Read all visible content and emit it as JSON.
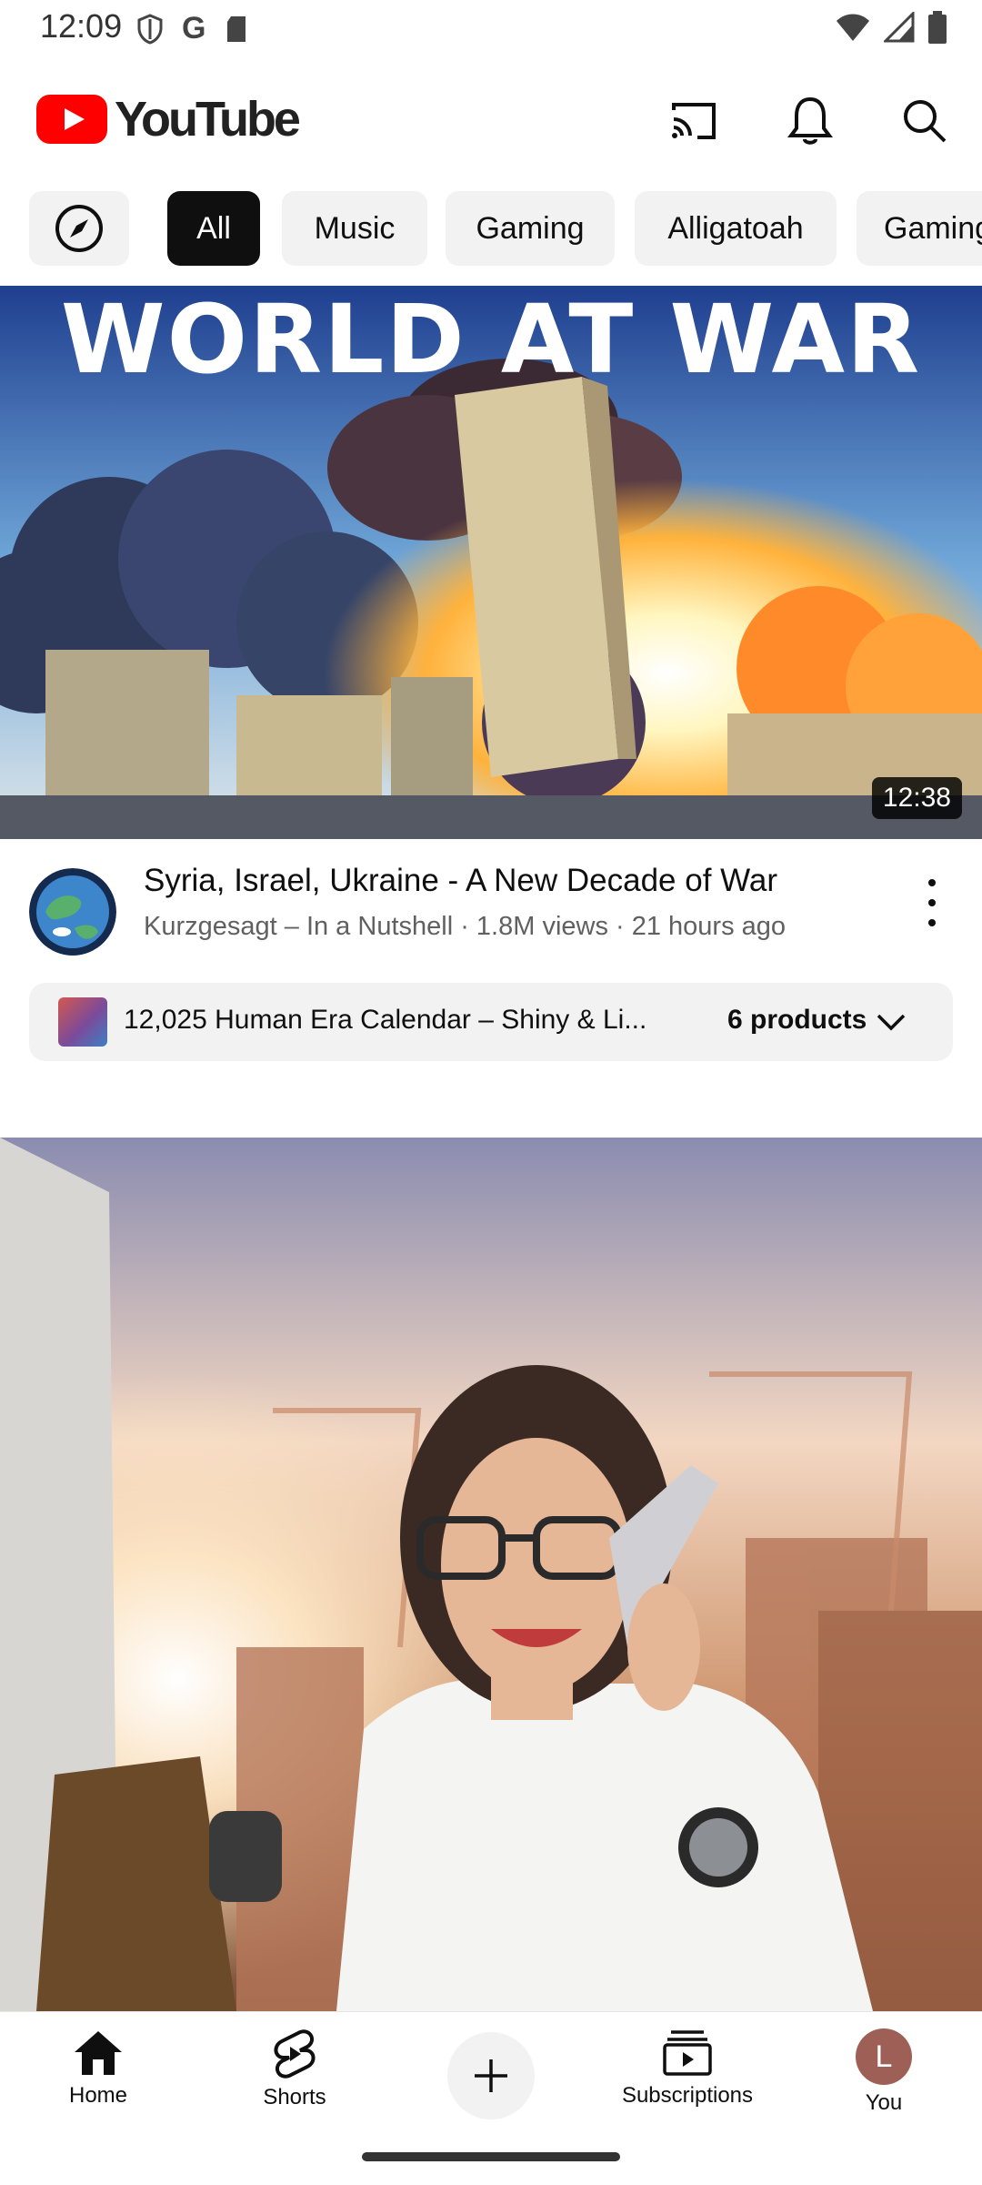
{
  "status_bar": {
    "time": "12:09"
  },
  "header": {
    "brand": "YouTube",
    "cast_icon": "cast-icon",
    "notifications_icon": "bell-icon",
    "search_icon": "search-icon"
  },
  "chips": [
    {
      "label": ""
    },
    {
      "label": "All"
    },
    {
      "label": "Music"
    },
    {
      "label": "Gaming"
    },
    {
      "label": "Alligatoah"
    },
    {
      "label": "Gaming"
    }
  ],
  "video1": {
    "thumbnail_text": "WORLD AT WAR",
    "duration": "12:38",
    "title": "Syria, Israel, Ukraine - A New Decade of War",
    "subtitle": "Kurzgesagt – In a Nutshell · 1.8M views · 21 hours ago",
    "products_name": "12,025 Human Era Calendar – Shiny & Li...",
    "products_count": "6 products"
  },
  "bottom_nav": {
    "home": "Home",
    "shorts": "Shorts",
    "subscriptions": "Subscriptions",
    "you": "You",
    "you_initial": "L"
  },
  "colors": {
    "brand_red": "#ff0000",
    "text": "#0f0f0f",
    "secondary_text": "#606060",
    "chip_bg": "#f2f2f2"
  }
}
